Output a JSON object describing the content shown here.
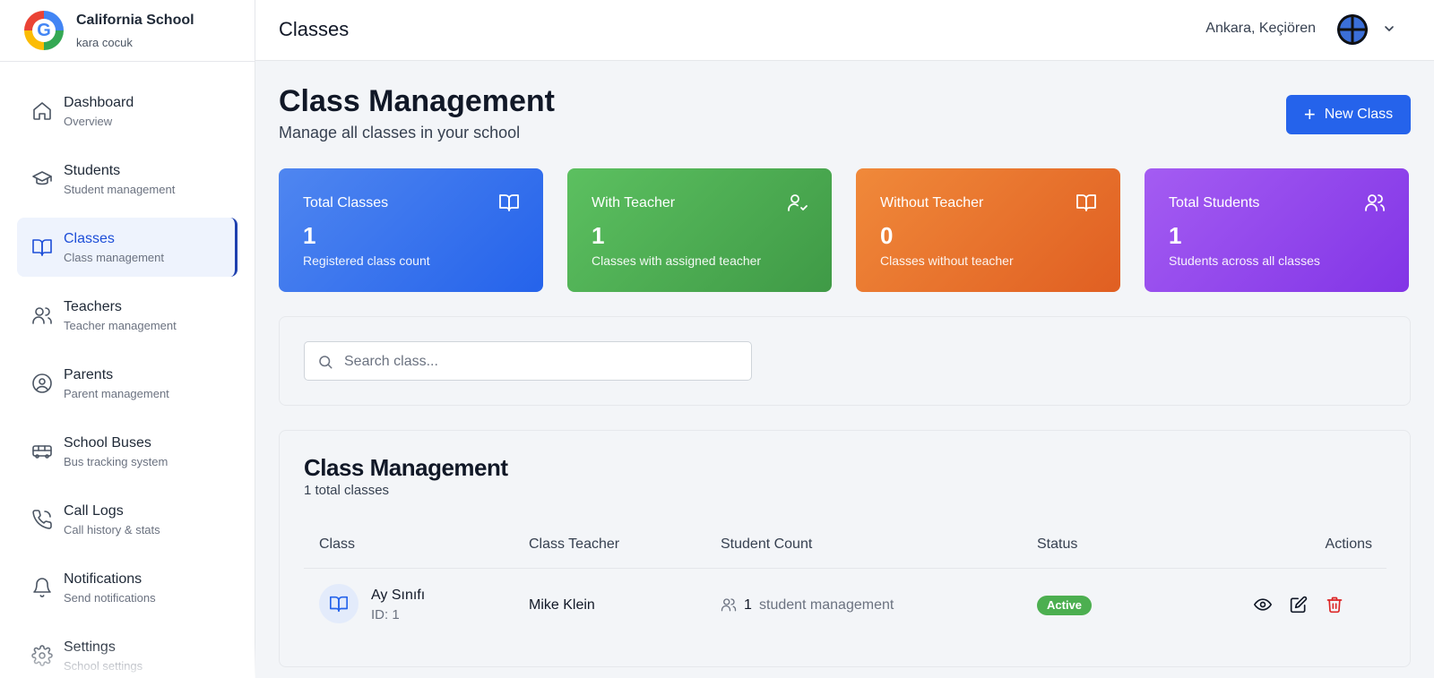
{
  "brand": {
    "name": "California School",
    "subtitle": "kara cocuk",
    "logo_letter": "G"
  },
  "sidebar": {
    "items": [
      {
        "label": "Dashboard",
        "sub": "Overview",
        "icon": "home-icon"
      },
      {
        "label": "Students",
        "sub": "Student management",
        "icon": "graduation-cap-icon"
      },
      {
        "label": "Classes",
        "sub": "Class management",
        "icon": "book-open-icon",
        "active": true
      },
      {
        "label": "Teachers",
        "sub": "Teacher management",
        "icon": "users-icon"
      },
      {
        "label": "Parents",
        "sub": "Parent management",
        "icon": "user-circle-icon"
      },
      {
        "label": "School Buses",
        "sub": "Bus tracking system",
        "icon": "bus-icon"
      },
      {
        "label": "Call Logs",
        "sub": "Call history & stats",
        "icon": "phone-icon"
      },
      {
        "label": "Notifications",
        "sub": "Send notifications",
        "icon": "bell-icon"
      },
      {
        "label": "Settings",
        "sub": "School settings",
        "icon": "gear-icon"
      }
    ]
  },
  "header": {
    "title": "Classes",
    "location": "Ankara, Keçiören"
  },
  "main": {
    "title": "Class Management",
    "subtitle": "Manage all classes in your school",
    "new_button": "New Class",
    "stats": [
      {
        "label": "Total Classes",
        "value": "1",
        "desc": "Registered class count",
        "color": "#2563eb",
        "icon": "book-open-icon"
      },
      {
        "label": "With Teacher",
        "value": "1",
        "desc": "Classes with assigned teacher",
        "color": "#43a047",
        "icon": "user-check-icon"
      },
      {
        "label": "Without Teacher",
        "value": "0",
        "desc": "Classes without teacher",
        "color": "#e8692b",
        "icon": "book-open-icon"
      },
      {
        "label": "Total Students",
        "value": "1",
        "desc": "Students across all classes",
        "color": "#8b3ff0",
        "icon": "users-icon"
      }
    ],
    "search": {
      "placeholder": "Search class..."
    },
    "table": {
      "title": "Class Management",
      "subtitle": "1 total classes",
      "columns": [
        "Class",
        "Class Teacher",
        "Student Count",
        "Status",
        "Actions"
      ],
      "rows": [
        {
          "name": "Ay Sınıfı",
          "id": "ID: 1",
          "teacher": "Mike Klein",
          "count": "1",
          "count_label": "student management",
          "status": "Active",
          "status_color": "#4caf50"
        }
      ]
    }
  }
}
